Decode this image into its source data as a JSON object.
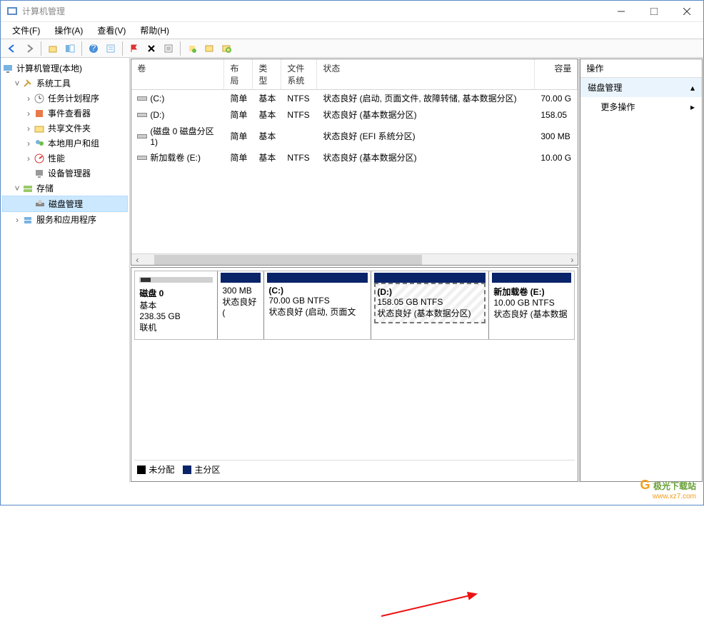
{
  "window": {
    "title": "计算机管理"
  },
  "menu": {
    "file": "文件(F)",
    "action": "操作(A)",
    "view": "查看(V)",
    "help": "帮助(H)"
  },
  "tree": {
    "root": "计算机管理(本地)",
    "sys_tools": "系统工具",
    "task_scheduler": "任务计划程序",
    "event_viewer": "事件查看器",
    "shared_folders": "共享文件夹",
    "local_users": "本地用户和组",
    "performance": "性能",
    "device_manager": "设备管理器",
    "storage": "存储",
    "disk_management": "磁盘管理",
    "services_apps": "服务和应用程序"
  },
  "grid": {
    "headers": {
      "volume": "卷",
      "layout": "布局",
      "type": "类型",
      "fs": "文件系统",
      "status": "状态",
      "capacity": "容量"
    },
    "rows": [
      {
        "vol": "(C:)",
        "layout": "简单",
        "type": "基本",
        "fs": "NTFS",
        "status": "状态良好 (启动, 页面文件, 故障转储, 基本数据分区)",
        "capacity": "70.00 G"
      },
      {
        "vol": "(D:)",
        "layout": "简单",
        "type": "基本",
        "fs": "NTFS",
        "status": "状态良好 (基本数据分区)",
        "capacity": "158.05"
      },
      {
        "vol": "(磁盘 0 磁盘分区 1)",
        "layout": "简单",
        "type": "基本",
        "fs": "",
        "status": "状态良好 (EFI 系统分区)",
        "capacity": "300 MB"
      },
      {
        "vol": "新加载卷 (E:)",
        "layout": "简单",
        "type": "基本",
        "fs": "NTFS",
        "status": "状态良好 (基本数据分区)",
        "capacity": "10.00 G"
      }
    ]
  },
  "disk": {
    "name": "磁盘 0",
    "type": "基本",
    "size": "238.35 GB",
    "online": "联机",
    "partitions": [
      {
        "title": "",
        "size": "300 MB",
        "status": "状态良好 (",
        "w": 65
      },
      {
        "title": "(C:)",
        "size": "70.00 GB NTFS",
        "status": "状态良好 (启动, 页面文",
        "w": 150
      },
      {
        "title": "(D:)",
        "size": "158.05 GB NTFS",
        "status": "状态良好 (基本数据分区)",
        "w": 165,
        "selected": true
      },
      {
        "title": "新加载卷   (E:)",
        "size": "10.00 GB NTFS",
        "status": "状态良好 (基本数据",
        "w": 120
      }
    ]
  },
  "legend": {
    "unallocated": "未分配",
    "primary": "主分区"
  },
  "actions": {
    "header": "操作",
    "disk_management": "磁盘管理",
    "more": "更多操作"
  },
  "watermark": {
    "name": "极光下载站",
    "url": "www.xz7.com"
  }
}
